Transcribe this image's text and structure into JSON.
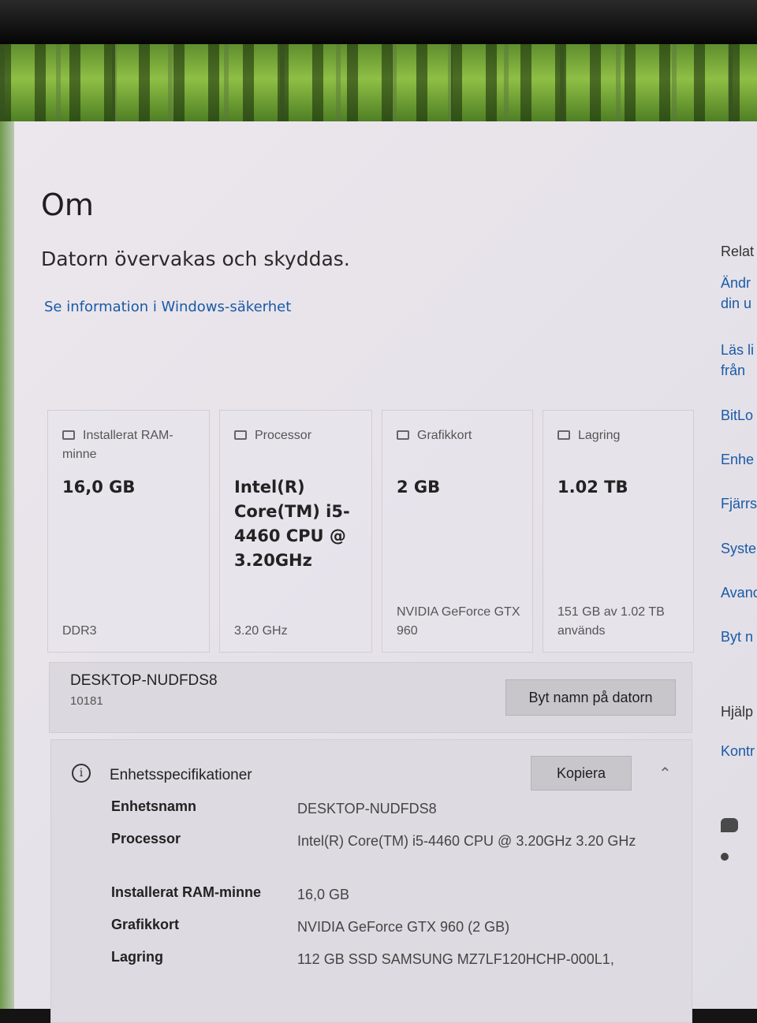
{
  "page": {
    "title": "Om",
    "protection_text": "Datorn övervakas och skyddas.",
    "security_link": "Se information i Windows-säkerhet"
  },
  "cards": [
    {
      "icon": "ram-icon",
      "heading": "Installerat RAM-minne",
      "value": "16,0 GB",
      "footer": "DDR3"
    },
    {
      "icon": "processor-icon",
      "heading": "Processor",
      "value": "Intel(R) Core(TM) i5-4460 CPU @ 3.20GHz",
      "footer": "3.20 GHz"
    },
    {
      "icon": "graphics-card-icon",
      "heading": "Grafikkort",
      "value": "2 GB",
      "footer": "NVIDIA GeForce GTX 960"
    },
    {
      "icon": "storage-icon",
      "heading": "Lagring",
      "value": "1.02 TB",
      "footer": "151 GB av 1.02 TB används"
    }
  ],
  "device": {
    "name": "DESKTOP-NUDFDS8",
    "sub": "10181",
    "rename_button": "Byt namn på datorn"
  },
  "specs": {
    "header": "Enhetsspecifikationer",
    "copy_button": "Kopiera",
    "rows": [
      {
        "label": "Enhetsnamn",
        "value": "DESKTOP-NUDFDS8"
      },
      {
        "label": "Processor",
        "value": "Intel(R) Core(TM) i5-4460 CPU @ 3.20GHz 3.20 GHz"
      },
      {
        "label": "Installerat RAM-minne",
        "value": "16,0 GB"
      },
      {
        "label": "Grafikkort",
        "value": "NVIDIA GeForce GTX 960 (2 GB)"
      },
      {
        "label": "Lagring",
        "value": "112 GB SSD SAMSUNG MZ7LF120HCHP-000L1,"
      }
    ]
  },
  "related": {
    "heading": "Relat",
    "links": [
      "Ändr",
      "din u",
      "Läs li",
      "från",
      "BitLo",
      "Enhe",
      "Fjärrs",
      "Syste",
      "Avanc",
      "Byt n"
    ],
    "help": [
      "Hjälp",
      "Kontr"
    ]
  }
}
